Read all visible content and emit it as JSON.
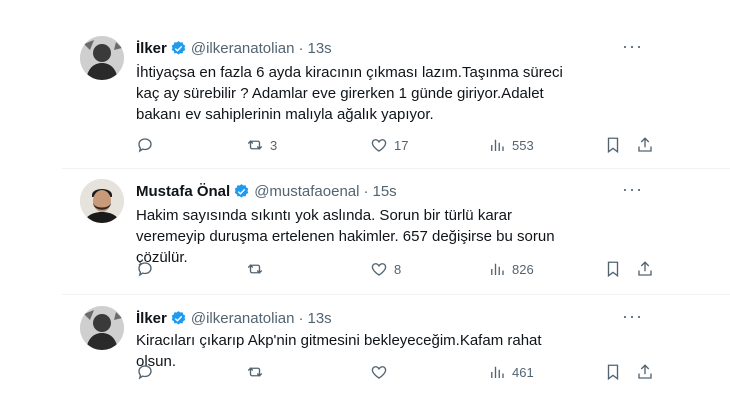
{
  "tweets": [
    {
      "name": "İlker",
      "handle": "@ilkeranatolian",
      "separator": "·",
      "time": "13s",
      "text": "İhtiyaçsa en fazla 6 ayda kiracının çıkması lazım.Taşınma süreci kaç ay sürebilir ? Adamlar eve girerken 1 günde giriyor.Adalet bakanı ev sahiplerinin malıyla ağalık yapıyor.",
      "replies": "",
      "retweets": "3",
      "likes": "17",
      "views": "553"
    },
    {
      "name": "Mustafa Önal",
      "handle": "@mustafaoenal",
      "separator": "·",
      "time": "15s",
      "text": "Hakim sayısında sıkıntı yok aslında. Sorun bir türlü karar veremeyip duruşma ertelenen hakimler. 657 değişirse bu sorun çözülür.",
      "replies": "",
      "retweets": "",
      "likes": "8",
      "views": "826"
    },
    {
      "name": "İlker",
      "handle": "@ilkeranatolian",
      "separator": "·",
      "time": "13s",
      "text": "Kiracıları çıkarıp Akp'nin gitmesini bekleyeceğim.Kafam rahat olsun.",
      "replies": "",
      "retweets": "",
      "likes": "",
      "views": "461"
    }
  ],
  "icons": {
    "more": "more-horizontal-icon",
    "verified": "verified-badge-icon",
    "reply": "reply-icon",
    "retweet": "retweet-icon",
    "like": "heart-icon",
    "views": "views-chart-icon",
    "bookmark": "bookmark-icon",
    "share": "share-icon"
  },
  "colors": {
    "text": "#0f1419",
    "secondary": "#536471",
    "verified": "#1d9bf0",
    "divider": "#eff3f4"
  }
}
